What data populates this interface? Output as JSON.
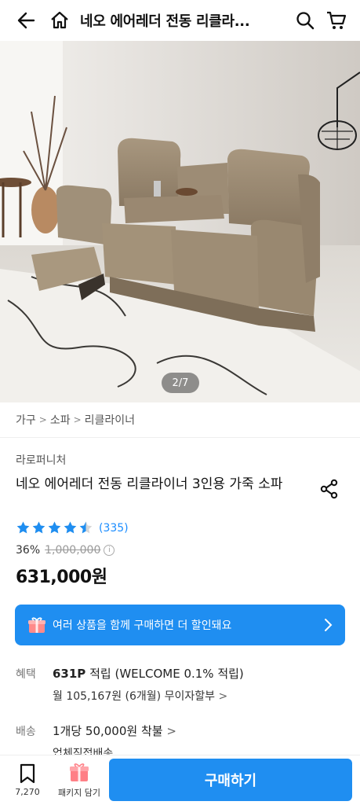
{
  "header": {
    "title": "네오 에어레더 전동 리클라...",
    "back_icon": "back-arrow-icon",
    "home_icon": "home-icon",
    "search_icon": "search-icon",
    "cart_icon": "cart-icon"
  },
  "gallery": {
    "counter": "2/7",
    "current": 2,
    "total": 7
  },
  "breadcrumb": [
    "가구",
    "소파",
    "리클라이너"
  ],
  "product": {
    "brand": "라로퍼니처",
    "name": "네오 에어레더 전동 리클라이너 3인용 가죽 소파",
    "rating": 4.5,
    "review_count": "(335)",
    "discount": "36%",
    "original_price": "1,000,000",
    "price": "631,000원"
  },
  "bundle_banner": {
    "text": "여러 상품을 함께 구매하면 더 할인돼요"
  },
  "benefits": {
    "label": "혜택",
    "points": "631P",
    "points_text": "적립 (WELCOME 0.1% 적립)",
    "installment": "월 105,167원 (6개월) 무이자할부"
  },
  "shipping": {
    "label": "배송",
    "fee": "1개당 50,000원 착불",
    "sub": "업체직접배송"
  },
  "bottom_bar": {
    "bookmark_count": "7,270",
    "package_label": "패키지 담기",
    "buy_label": "구매하기"
  },
  "colors": {
    "accent": "#1f8ef1",
    "star": "#1f8ef1",
    "link": "#1a8cff"
  }
}
